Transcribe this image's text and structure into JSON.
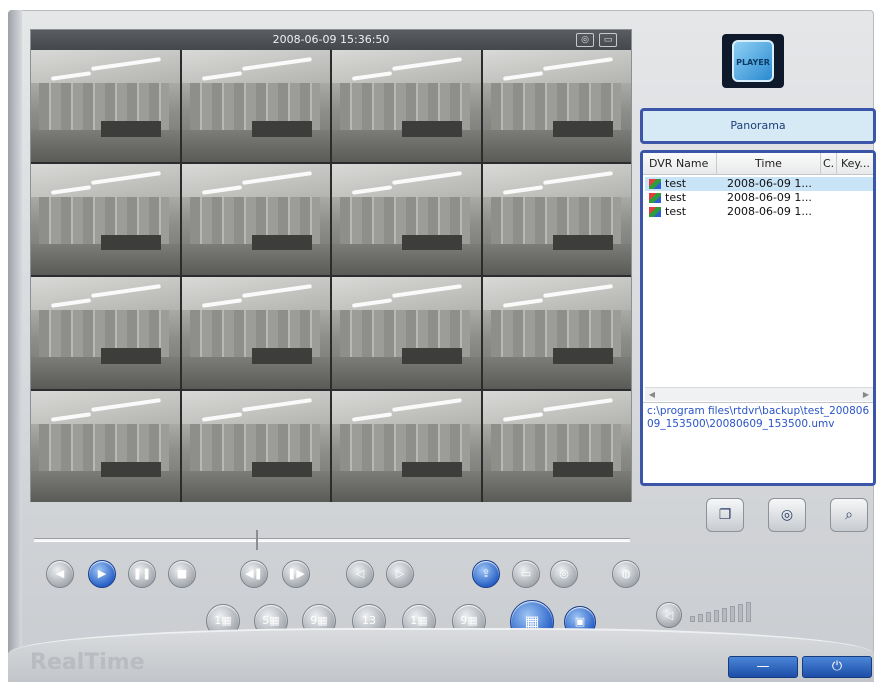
{
  "video": {
    "timestamp": "2008-06-09 15:36:50",
    "header_icons": [
      "camera-icon",
      "screen-icon"
    ],
    "channels": 16
  },
  "playback": {
    "position": 0.38
  },
  "logo": {
    "text": "PLAYER"
  },
  "panorama": {
    "label": "Panorama"
  },
  "file_list": {
    "columns": [
      "DVR Name",
      "Time",
      "C.",
      "Key..."
    ],
    "rows": [
      {
        "name": "test",
        "time": "2008-06-09 1...",
        "selected": true
      },
      {
        "name": "test",
        "time": "2008-06-09 1...",
        "selected": false
      },
      {
        "name": "test",
        "time": "2008-06-09 1...",
        "selected": false
      }
    ],
    "path": "c:\\program files\\rtdvr\\backup\\test_20080609_153500\\20080609_153500.umv"
  },
  "controls": {
    "transport": [
      "rewind",
      "play",
      "pause",
      "stop",
      "step-back",
      "step-forward",
      "slow",
      "fast"
    ],
    "tools": [
      "export-icon",
      "print-icon",
      "snapshot-icon",
      "audio-tape-icon"
    ],
    "layouts": [
      "1",
      "5",
      "9",
      "13",
      "1",
      "9"
    ]
  },
  "right_tools": [
    "folder-icon",
    "search-snapshot-icon",
    "search-zoom-icon"
  ],
  "volume": {
    "level": 0.0
  },
  "status": {
    "mode": "RealTime"
  },
  "window": {
    "minimize_label": "—",
    "power_label": "⏻"
  }
}
